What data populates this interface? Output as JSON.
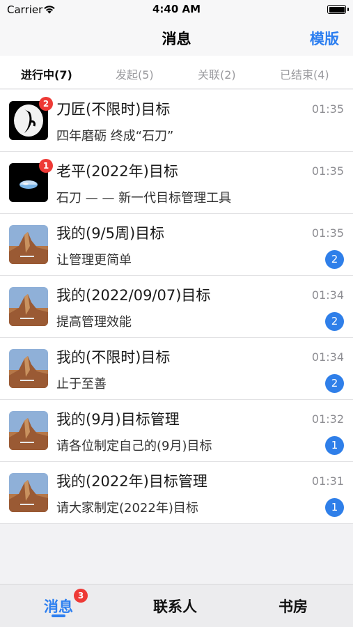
{
  "status_bar": {
    "carrier": "Carrier",
    "time": "4:40 AM"
  },
  "nav": {
    "title": "消息",
    "right_action": "模版"
  },
  "tabs": [
    {
      "label": "进行中(7)",
      "active": true
    },
    {
      "label": "发起(5)",
      "active": false
    },
    {
      "label": "关联(2)",
      "active": false
    },
    {
      "label": "已结束(4)",
      "active": false
    }
  ],
  "messages": [
    {
      "title": "刀匠(不限时)目标",
      "subtitle": "四年磨砺 终成“石刀”",
      "time": "01:35",
      "avatar": "knife-logo",
      "corner_badge": "2",
      "count": ""
    },
    {
      "title": "老平(2022年)目标",
      "subtitle": "石刀 — — 新一代目标管理工具",
      "time": "01:35",
      "avatar": "earth-photo",
      "corner_badge": "1",
      "count": ""
    },
    {
      "title": "我的(9/5周)目标",
      "subtitle": "让管理更简单",
      "time": "01:35",
      "avatar": "rock-landscape",
      "corner_badge": "",
      "count": "2"
    },
    {
      "title": "我的(2022/09/07)目标",
      "subtitle": "提高管理效能",
      "time": "01:34",
      "avatar": "rock-landscape",
      "corner_badge": "",
      "count": "2"
    },
    {
      "title": "我的(不限时)目标",
      "subtitle": "止于至善",
      "time": "01:34",
      "avatar": "rock-landscape",
      "corner_badge": "",
      "count": "2"
    },
    {
      "title": "我的(9月)目标管理",
      "subtitle": "请各位制定自己的(9月)目标",
      "time": "01:32",
      "avatar": "rock-landscape",
      "corner_badge": "",
      "count": "1"
    },
    {
      "title": "我的(2022年)目标管理",
      "subtitle": "请大家制定(2022年)目标",
      "time": "01:31",
      "avatar": "rock-landscape",
      "corner_badge": "",
      "count": "1"
    }
  ],
  "bottom_tabs": [
    {
      "label": "消息",
      "active": true,
      "badge": "3"
    },
    {
      "label": "联系人",
      "active": false,
      "badge": ""
    },
    {
      "label": "书房",
      "active": false,
      "badge": ""
    }
  ],
  "colors": {
    "accent": "#2d7ff0",
    "badge_red": "#ee3a36",
    "count_blue": "#2f7fe9"
  }
}
